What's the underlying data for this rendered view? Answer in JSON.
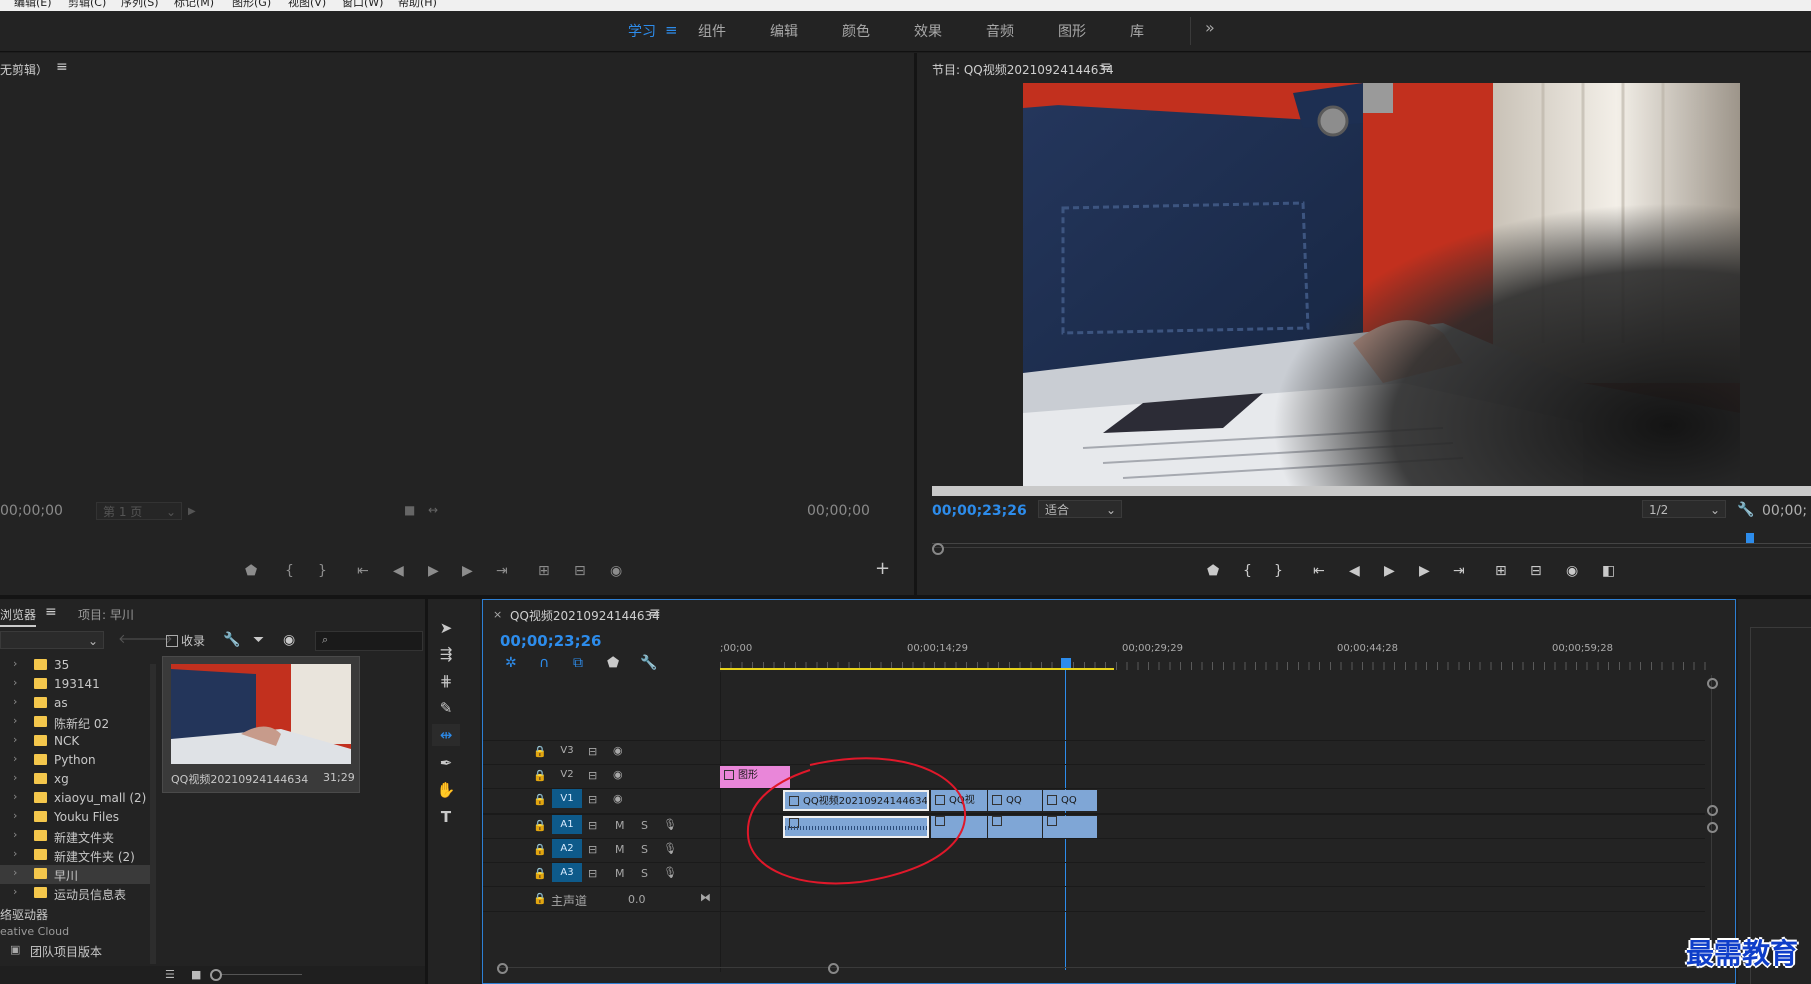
{
  "menu": [
    "编辑(E)",
    "剪辑(C)",
    "序列(S)",
    "标记(M)",
    "图形(G)",
    "视图(V)",
    "窗口(W)",
    "帮助(H)"
  ],
  "workspaces": [
    {
      "label": "学习",
      "active": true
    },
    {
      "label": "组件",
      "active": false
    },
    {
      "label": "编辑",
      "active": false
    },
    {
      "label": "颜色",
      "active": false
    },
    {
      "label": "效果",
      "active": false
    },
    {
      "label": "音频",
      "active": false
    },
    {
      "label": "图形",
      "active": false
    },
    {
      "label": "库",
      "active": false
    }
  ],
  "overflow": "»",
  "source": {
    "title": "无剪辑）",
    "tc_left": "00;00;00",
    "page": "第 1 页",
    "tc_right": "00;00;00"
  },
  "program": {
    "title": "节目: QQ视频20210924144634",
    "tc": "00;00;23;26",
    "fit": "适合",
    "res": "1/2",
    "tc_right": "00;00;"
  },
  "browser": {
    "tabs": [
      "浏览器",
      "项目: 早川"
    ],
    "collect": "收录",
    "items": [
      "35",
      "193141",
      "as",
      "陈新纪 02",
      "NCK",
      "Python",
      "xg",
      "xiaoyu_mall (2)",
      "Youku Files",
      "新建文件夹",
      "新建文件夹 (2)",
      "早川",
      "运动员信息表"
    ],
    "selected": "早川",
    "extra": [
      "络驱动器",
      "eative Cloud",
      "团队项目版本"
    ],
    "thumb": {
      "name": "QQ视频20210924144634",
      "dur": "31;29"
    }
  },
  "timeline": {
    "title": "QQ视频20210924144634",
    "tc": "00;00;23;26",
    "ruler": [
      ";00;00",
      "00;00;14;29",
      "00;00;29;29",
      "00;00;44;28",
      "00;00;59;28"
    ],
    "tracks": [
      {
        "name": "V3",
        "type": "video"
      },
      {
        "name": "V2",
        "type": "video"
      },
      {
        "name": "V1",
        "type": "video",
        "sel": true
      },
      {
        "name": "A1",
        "type": "audio",
        "sel": true
      },
      {
        "name": "A2",
        "type": "audio"
      },
      {
        "name": "A3",
        "type": "audio"
      }
    ],
    "master": {
      "label": "主声道",
      "value": "0.0"
    },
    "clips": {
      "graphic": "图形",
      "v1_main": "QQ视频20210924144634.",
      "v1_b": "QQ视",
      "v1_c": "QQ",
      "v1_d": "QQ"
    },
    "m": "M",
    "s": "S"
  },
  "watermark": "最需教育",
  "colors": {
    "accent": "#2d8ceb",
    "graphic_clip": "#e986d9",
    "video_clip": "#7fa6d6",
    "annotation": "#e0182a",
    "folder": "#f4c74c"
  }
}
